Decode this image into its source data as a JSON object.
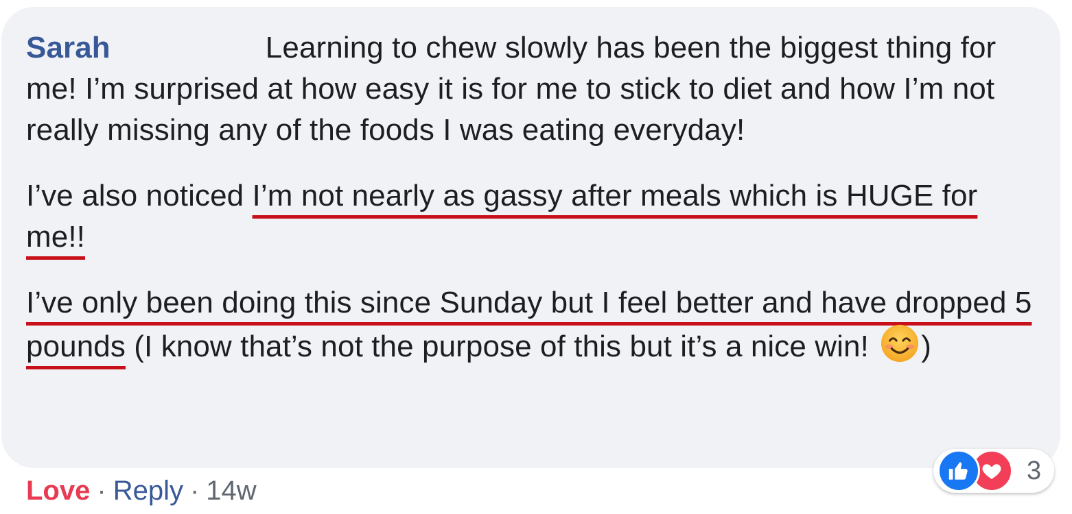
{
  "comment": {
    "author": "Sarah",
    "paragraph1": "Learning to chew slowly has been the biggest thing for me! I’m surprised at how easy it is for me to stick to diet and how I’m not really missing any of the foods I was eating everyday!",
    "paragraph2": {
      "before": "I’ve also noticed ",
      "highlight": "I’m not nearly as gassy after meals which is HUGE for me!!"
    },
    "paragraph3": {
      "highlight": "I’ve only been doing this since Sunday but I feel better and have dropped 5 pounds",
      "after": " (I know that’s not the purpose of this but it’s a nice win! ",
      "emoji": "smiling-face-emoji",
      "closing": ")"
    }
  },
  "actions": {
    "love_label": "Love",
    "separator": "·",
    "reply_label": "Reply",
    "time": "14w"
  },
  "reactions": {
    "icons": [
      "like-icon",
      "love-icon"
    ],
    "count": "3",
    "like_color": "#1877f2",
    "love_color": "#f33e58"
  },
  "colors": {
    "author": "#385898",
    "love_action": "#e83a52",
    "bubble_bg": "#f0f2f5",
    "underline": "#c8101a"
  }
}
